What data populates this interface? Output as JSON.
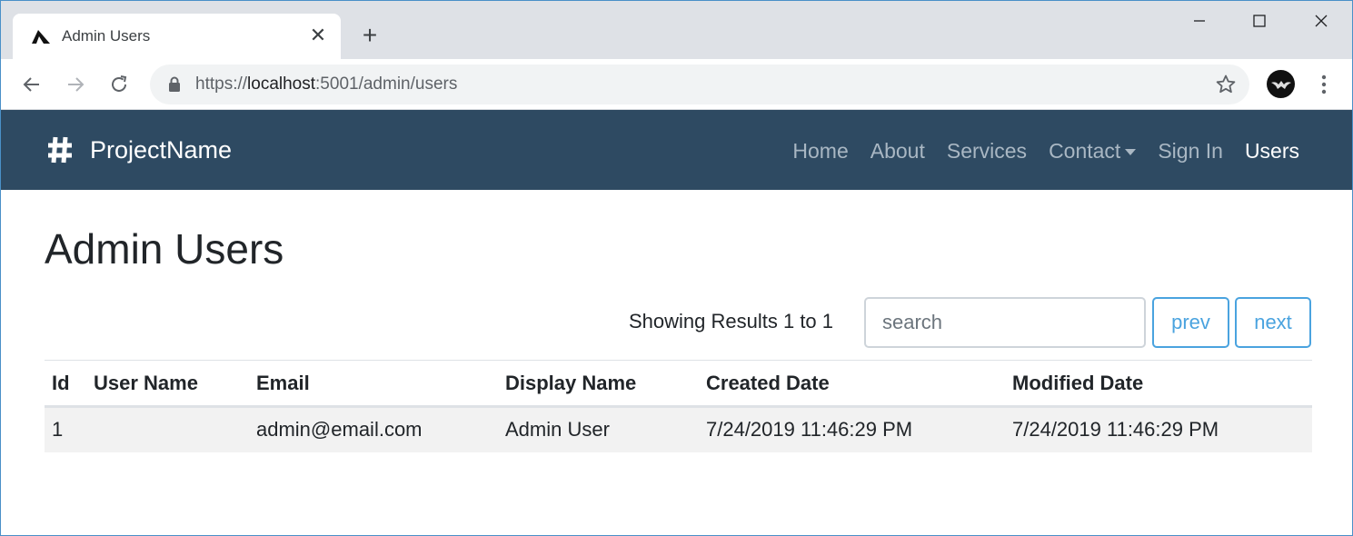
{
  "browser": {
    "tab_title": "Admin Users",
    "url_scheme": "https://",
    "url_host": "localhost",
    "url_rest": ":5001/admin/users"
  },
  "navbar": {
    "brand": "ProjectName",
    "links": [
      {
        "label": "Home"
      },
      {
        "label": "About"
      },
      {
        "label": "Services"
      },
      {
        "label": "Contact"
      },
      {
        "label": "Sign In"
      },
      {
        "label": "Users"
      }
    ]
  },
  "page": {
    "title": "Admin Users",
    "results_text": "Showing Results 1 to 1",
    "search_placeholder": "search",
    "prev_label": "prev",
    "next_label": "next"
  },
  "table": {
    "headers": [
      "Id",
      "User Name",
      "Email",
      "Display Name",
      "Created Date",
      "Modified Date"
    ],
    "rows": [
      [
        "1",
        "",
        "admin@email.com",
        "Admin User",
        "7/24/2019 11:46:29 PM",
        "7/24/2019 11:46:29 PM"
      ]
    ]
  },
  "colors": {
    "navbar_bg": "#2e4a62",
    "accent": "#4aa3df"
  }
}
